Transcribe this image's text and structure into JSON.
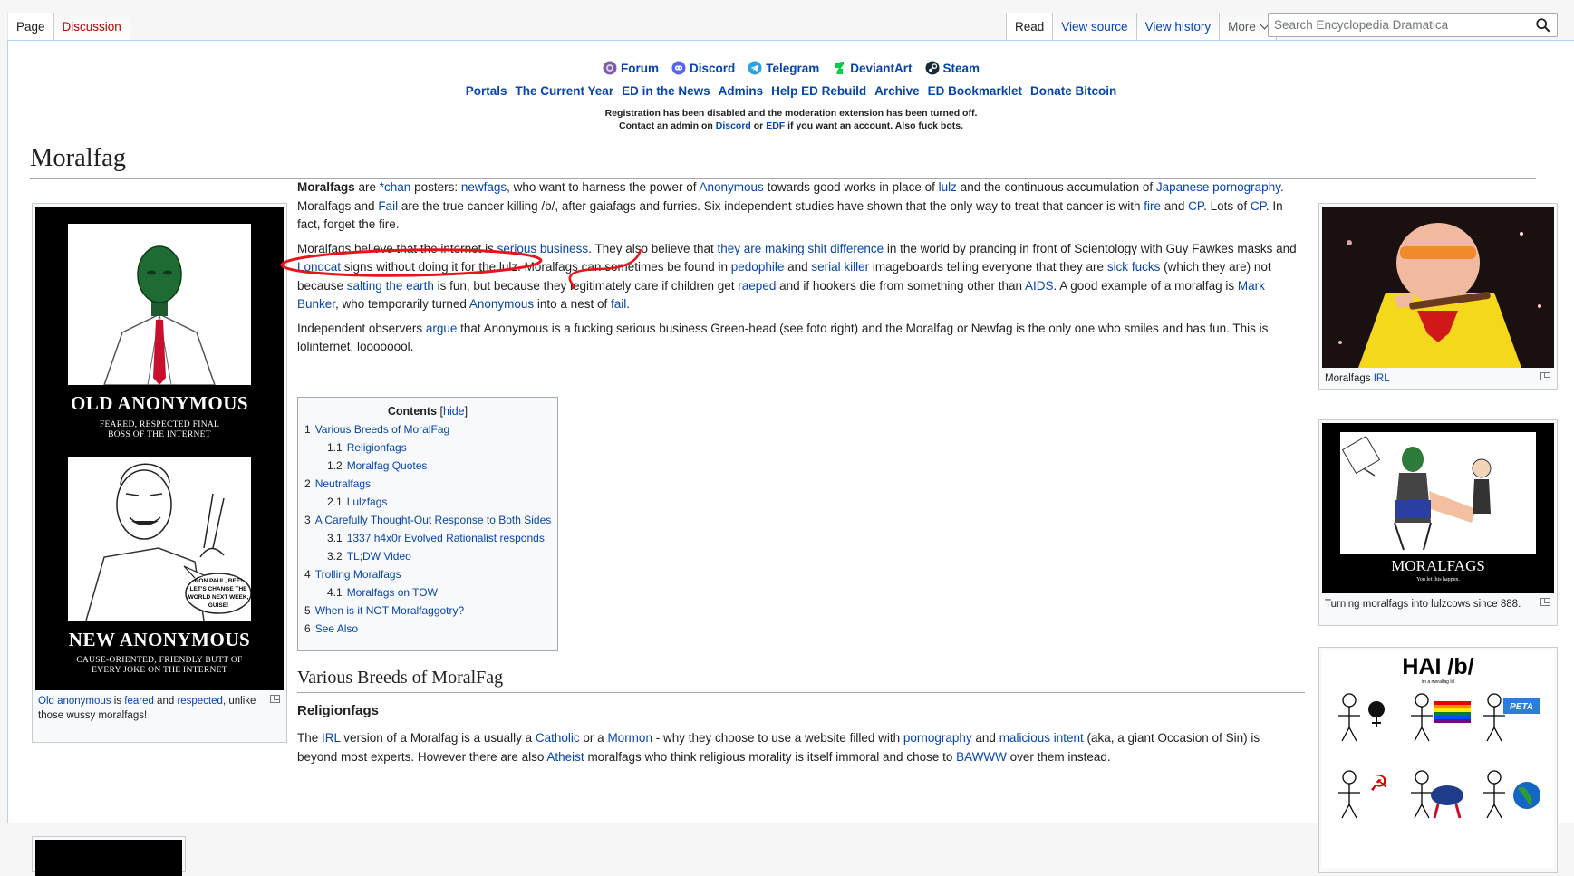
{
  "tabs": {
    "page": "Page",
    "discussion": "Discussion",
    "read": "Read",
    "view_source": "View source",
    "view_history": "View history",
    "more": "More"
  },
  "search": {
    "placeholder": "Search Encyclopedia Dramatica"
  },
  "sitenotice": {
    "icon_links": [
      "Forum",
      "Discord",
      "Telegram",
      "DeviantArt",
      "Steam"
    ],
    "text_links": [
      "Portals",
      "The Current Year",
      "ED in the News",
      "Admins",
      "Help ED Rebuild",
      "Archive",
      "ED Bookmarklet",
      "Donate Bitcoin"
    ],
    "notice_line1": "Registration has been disabled and the moderation extension has been turned off.",
    "notice_line2_a": "Contact an admin on ",
    "notice_line2_discord": "Discord",
    "notice_line2_or": " or ",
    "notice_line2_edf": "EDF",
    "notice_line2_b": " if you want an account. Also fuck bots."
  },
  "title": "Moralfag",
  "left_thumb": {
    "top_title": "OLD ANONYMOUS",
    "top_sub1": "FEARED, RESPECTED FINAL",
    "top_sub2": "BOSS OF THE INTERNET",
    "bottom_title": "NEW ANONYMOUS",
    "bottom_sub1": "CAUSE-ORIENTED, FRIENDLY BUTT OF",
    "bottom_sub2": "EVERY JOKE ON THE INTERNET",
    "bubble1": "RON PAUL, BEE!",
    "bubble2": "LET'S CHANGE THE",
    "bubble3": "WORLD NEXT WEEK,",
    "bubble4": "GUISE!",
    "cap_link1": "Old anonymous",
    "cap_t1": " is ",
    "cap_link2": "feared",
    "cap_t2": " and ",
    "cap_link3": "respected",
    "cap_t3": ", unlike those wussy moralfags!"
  },
  "right_thumbs": {
    "cap1_text": "Moralfags ",
    "cap1_link": "IRL",
    "poster2_title": "MORALFAGS",
    "poster2_sub": "You let this happen.",
    "cap2_text": "Turning moralfags into lulzcows since 888.",
    "poster3_title": "HAI /b/",
    "poster3_sub": "im a moralfag lol",
    "poster3_peta": "PETA"
  },
  "para1": {
    "b": "Moralfags",
    "t1": " are ",
    "l1": "*chan",
    "t2": " posters: ",
    "l2": "newfags",
    "t3": ", who want to harness the power of ",
    "l3": "Anonymous",
    "t4": " towards good works in place of ",
    "l4": "lulz",
    "t5": " and the continuous accumulation of ",
    "l5": "Japanese pornography",
    "t6": ". Moralfags and ",
    "l6": "Fail",
    "t7": " are the true cancer killing /b/, after gaiafags and furries. Six independent studies have shown that the only way to treat that cancer is with ",
    "l7": "fire",
    "t8": " and ",
    "l8": "CP",
    "t9": ". Lots of ",
    "l9": "CP",
    "t10": ". In fact, forget the fire."
  },
  "para2": {
    "t1": "Moralfags believe that the internet is ",
    "l1": "serious business",
    "t2": ". They also believe that ",
    "l2": "they are making shit difference",
    "t3": " in the world by prancing in front of Scientology with Guy Fawkes masks and ",
    "l3": "Longcat",
    "t4": " signs without doing it for the lulz. Moralfags can sometimes be found in ",
    "l4": "pedophile",
    "t5": " and ",
    "l5": "serial killer",
    "t6": " imageboards telling everyone that they are ",
    "l6": "sick fucks",
    "t7": " (which they are) not because ",
    "l7": "salting the earth",
    "t8": " is fun, but because they legitimately care if children get ",
    "l8": "raeped",
    "t9": " and if hookers die from something other than ",
    "l9": "AIDS",
    "t10": ". A good example of a moralfag is ",
    "l10": "Mark Bunker",
    "t11": ", who temporarily turned ",
    "l11": "Anonymous",
    "t12": " into a nest of ",
    "l12": "fail",
    "t13": "."
  },
  "para3": {
    "t1": "Independent observers ",
    "l1": "argue",
    "t2": " that Anonymous is a fucking serious business Green-head (see foto right) and the Moralfag or Newfag is the only one who smiles and has fun. This is lolinternet, loooooool."
  },
  "toc": {
    "title": "Contents",
    "hide": "hide",
    "items": [
      {
        "num": "1",
        "label": "Various Breeds of MoralFag"
      },
      {
        "num": "1.1",
        "label": "Religionfags"
      },
      {
        "num": "1.2",
        "label": "Moralfag Quotes"
      },
      {
        "num": "2",
        "label": "Neutralfags"
      },
      {
        "num": "2.1",
        "label": "Lulzfags"
      },
      {
        "num": "3",
        "label": "A Carefully Thought-Out Response to Both Sides"
      },
      {
        "num": "3.1",
        "label": "1337 h4x0r Evolved Rationalist responds"
      },
      {
        "num": "3.2",
        "label": "TL;DW Video"
      },
      {
        "num": "4",
        "label": "Trolling Moralfags"
      },
      {
        "num": "4.1",
        "label": "Moralfags on TOW"
      },
      {
        "num": "5",
        "label": "When is it NOT Moralfaggotry?"
      },
      {
        "num": "6",
        "label": "See Also"
      }
    ]
  },
  "section1": {
    "heading": "Various Breeds of MoralFag",
    "subheading": "Religionfags"
  },
  "para4": {
    "t1": "The ",
    "l1": "IRL",
    "t2": " version of a Moralfag is a usually a ",
    "l2": "Catholic",
    "t3": " or a ",
    "l3": "Mormon",
    "t4": " - why they choose to use a website filled with ",
    "l4": "pornography",
    "t5": " and ",
    "l5": "malicious intent",
    "t6": " (aka, a giant Occasion of Sin) is beyond most experts. However there are also ",
    "l6": "Atheist",
    "t7": " moralfags who think religious morality is itself immoral and chose to ",
    "l7": "BAWWW",
    "t8": " over them instead."
  },
  "colors": {
    "link": "#0645ad",
    "redlink": "#ba0000",
    "border": "#a7d7f9",
    "annotation": "#e8141a"
  },
  "icons": [
    "forum-icon",
    "discord-icon",
    "telegram-icon",
    "deviantart-icon",
    "steam-icon",
    "search-icon",
    "magnify-icon"
  ]
}
